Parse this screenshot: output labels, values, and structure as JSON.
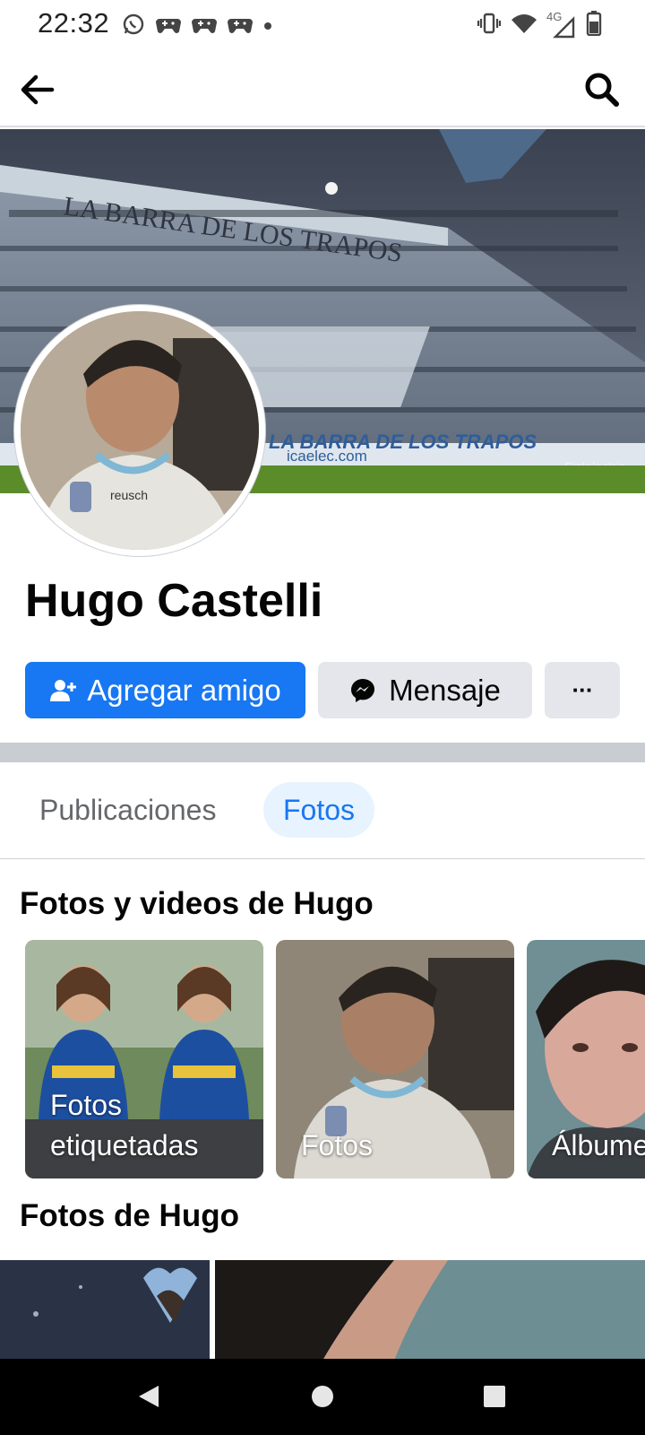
{
  "status_bar": {
    "time": "22:32",
    "network": "4G",
    "left_icons": [
      "whatsapp-icon",
      "game-controller-icon",
      "game-controller-icon",
      "game-controller-icon",
      "dot-icon"
    ],
    "right_icons": [
      "vibrate-icon",
      "wifi-icon",
      "signal-icon",
      "battery-icon"
    ]
  },
  "top_nav": {
    "back_icon": "arrow-left-icon",
    "search_icon": "search-icon"
  },
  "profile": {
    "name": "Hugo Castelli",
    "cover_texts": [
      "LA BARRA DE LOS TRAPOS",
      "LA BARRA DE LOS TRAPOS",
      "icaelec.com",
      "Sistelectric"
    ],
    "actions": {
      "add_friend": "Agregar amigo",
      "message": "Mensaje",
      "more": "···"
    }
  },
  "tabs": [
    {
      "label": "Publicaciones",
      "active": false
    },
    {
      "label": "Fotos",
      "active": true
    }
  ],
  "albums_section": {
    "title": "Fotos y videos de Hugo",
    "albums": [
      {
        "label": "Fotos\netiquetadas"
      },
      {
        "label": "Fotos"
      },
      {
        "label": "Álbumes"
      }
    ]
  },
  "photos_section": {
    "title": "Fotos de Hugo"
  },
  "colors": {
    "accent": "#1877f2",
    "accent_light": "#e7f3ff",
    "button_gray": "#e4e6eb",
    "text_secondary": "#65676b"
  },
  "system_nav": [
    "back-triangle-icon",
    "home-circle-icon",
    "recents-square-icon"
  ]
}
